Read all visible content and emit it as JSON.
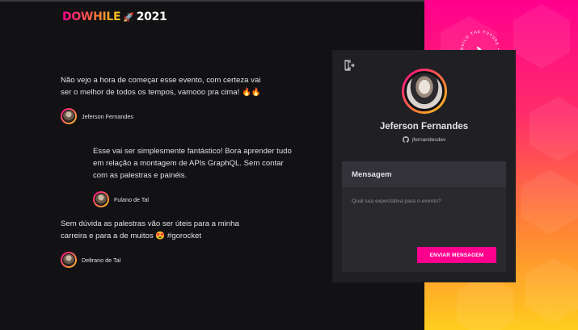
{
  "logo": {
    "brand": "DOWHILE",
    "rocket": "🚀",
    "year": "2021"
  },
  "badge": {
    "text": "BUILD THE FUTURE • BUILD THE FUTURE •"
  },
  "messages": [
    {
      "text": "Não vejo a hora de começar esse evento, com certeza vai ser o melhor de todos os tempos, vamooo pra cima! 🔥🔥",
      "author": "Jeferson Fernandes"
    },
    {
      "text": "Esse vai ser simplesmente fantástico! Bora aprender tudo em relação a montagem de APIs GraphQL. Sem contar com as palestras e painéis.",
      "author": "Fulano de Tal"
    },
    {
      "text": "Sem dúvida as palestras vão ser úteis para a minha carreira e para a de muitos 😍 #gorocket",
      "author": "Deltrano de Tal"
    }
  ],
  "profile": {
    "name": "Jeferson Fernandes",
    "username": "jfernandesdev"
  },
  "form": {
    "title": "Mensagem",
    "placeholder": "Qual sua expectativa para o evento?",
    "submit_label": "ENVIAR MENSAGEM"
  },
  "colors": {
    "background": "#121214",
    "card": "#202024",
    "accent": "#ff008e",
    "gradient_end": "#ffcd1e"
  }
}
